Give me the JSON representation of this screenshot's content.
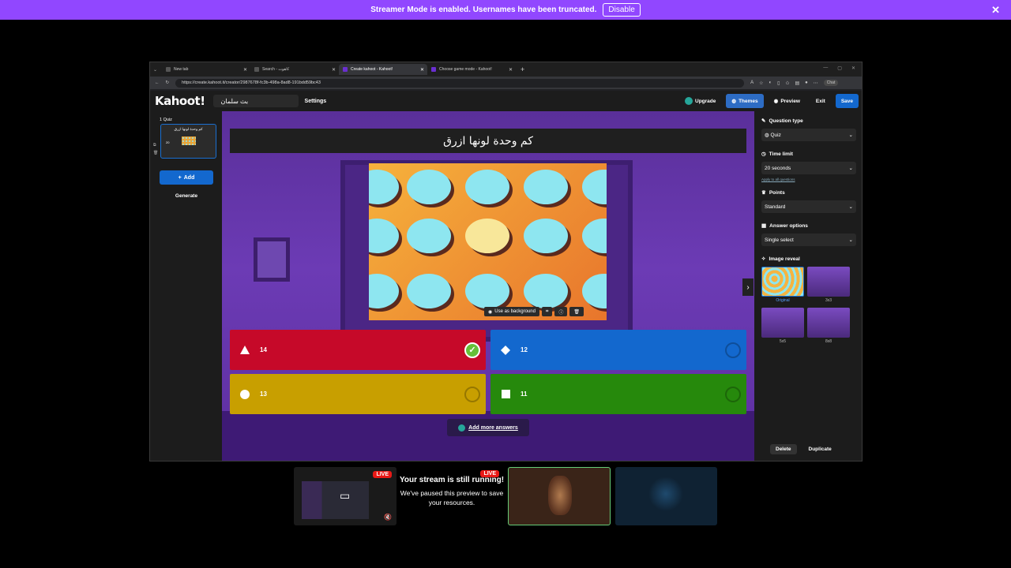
{
  "banner": {
    "text": "Streamer Mode is enabled. Usernames have been truncated.",
    "disable_label": "Disable",
    "close_icon": "close-icon"
  },
  "browser": {
    "tabs": [
      {
        "label": "New tab"
      },
      {
        "label": "Search - كاهوت"
      },
      {
        "label": "Create kahoot - Kahoot!"
      },
      {
        "label": "Choose game mode - Kahoot!"
      }
    ],
    "url": "https://create.kahoot.it/creator/2987678f-fc3b-498a-8ad8-191bdd59bc43",
    "chat_label": "Chat"
  },
  "kahoot": {
    "logo": "Kahoot!",
    "title": "بث سلمان",
    "settings_label": "Settings",
    "upgrade_label": "Upgrade",
    "themes_label": "Themes",
    "preview_label": "Preview",
    "exit_label": "Exit",
    "save_label": "Save",
    "sidebar": {
      "quiz_label": "1  Quiz",
      "slide_title": "كم وحدة لونها ازرق",
      "slide_time": "20",
      "add_label": "Add",
      "generate_label": "Generate"
    },
    "question": "كم وحدة لونها ازرق",
    "image_tools": {
      "background_label": "Use as background"
    },
    "answers": [
      {
        "text": "14",
        "correct": true,
        "color": "#c60929",
        "shape": "triangle"
      },
      {
        "text": "12",
        "correct": false,
        "color": "#1368ce",
        "shape": "diamond"
      },
      {
        "text": "13",
        "correct": false,
        "color": "#c89f00",
        "shape": "circle"
      },
      {
        "text": "11",
        "correct": false,
        "color": "#26890c",
        "shape": "square"
      }
    ],
    "add_more_label": "Add more answers",
    "panel": {
      "question_type_label": "Question type",
      "question_type_value": "Quiz",
      "time_limit_label": "Time limit",
      "time_limit_value": "20 seconds",
      "apply_all_label": "Apply to all questions",
      "points_label": "Points",
      "points_value": "Standard",
      "answer_options_label": "Answer options",
      "answer_options_value": "Single select",
      "image_reveal_label": "Image reveal",
      "reveal_options": [
        "Original",
        "3x3",
        "5x5",
        "8x8"
      ],
      "delete_label": "Delete",
      "duplicate_label": "Duplicate"
    }
  },
  "streams": {
    "live_label": "LIVE",
    "paused_title": "Your stream is still running!",
    "paused_sub": "We've paused this preview to save your resources."
  }
}
